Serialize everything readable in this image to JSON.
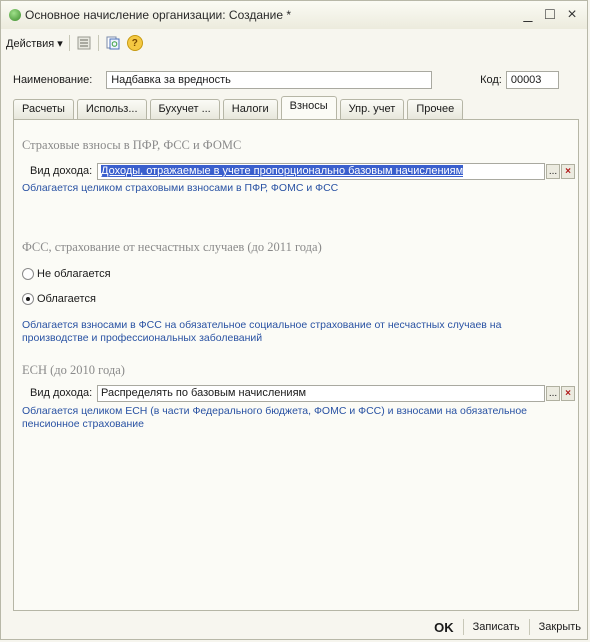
{
  "window": {
    "title": "Основное начисление организации: Создание *",
    "minimize": "_",
    "maximize": "□",
    "close": "×"
  },
  "toolbar": {
    "actions_label": "Действия ▾",
    "help": "?"
  },
  "header": {
    "name_label": "Наименование:",
    "name_value": "Надбавка за вредность",
    "code_label": "Код:",
    "code_value": "00003"
  },
  "tabs": [
    {
      "label": "Расчеты"
    },
    {
      "label": "Использ..."
    },
    {
      "label": "Бухучет ..."
    },
    {
      "label": "Налоги"
    },
    {
      "label": "Взносы"
    },
    {
      "label": "Упр. учет"
    },
    {
      "label": "Прочее"
    }
  ],
  "sections": {
    "insurance": {
      "title": "Страховые взносы в ПФР, ФСС и ФОМС",
      "income_label": "Вид дохода:",
      "income_value": "Доходы, отражаемые в учете пропорционально базовым начислениям",
      "description": "Облагается целиком страховыми взносами в ПФР, ФОМС и ФСС"
    },
    "fss": {
      "title": "ФСС, страхование от несчастных случаев (до 2011 года)",
      "option_not_taxed": "Не облагается",
      "option_taxed": "Облагается",
      "description": "Облагается взносами в ФСС на обязательное социальное страхование от несчастных случаев на производстве и профессиональных заболеваний"
    },
    "esn": {
      "title": "ЕСН (до 2010 года)",
      "income_label": "Вид дохода:",
      "income_value": "Распределять по базовым начислениям",
      "description": "Облагается целиком ЕСН (в части Федерального бюджета, ФОМС и ФСС) и взносами на обязательное пенсионное страхование"
    }
  },
  "field_buttons": {
    "select": "...",
    "clear": "×"
  },
  "footer": {
    "ok": "OK",
    "save": "Записать",
    "close": "Закрыть"
  },
  "colors": {
    "selection": "#3a5fcd",
    "link_text": "#2952a3",
    "section_title": "#8a8a8a"
  }
}
